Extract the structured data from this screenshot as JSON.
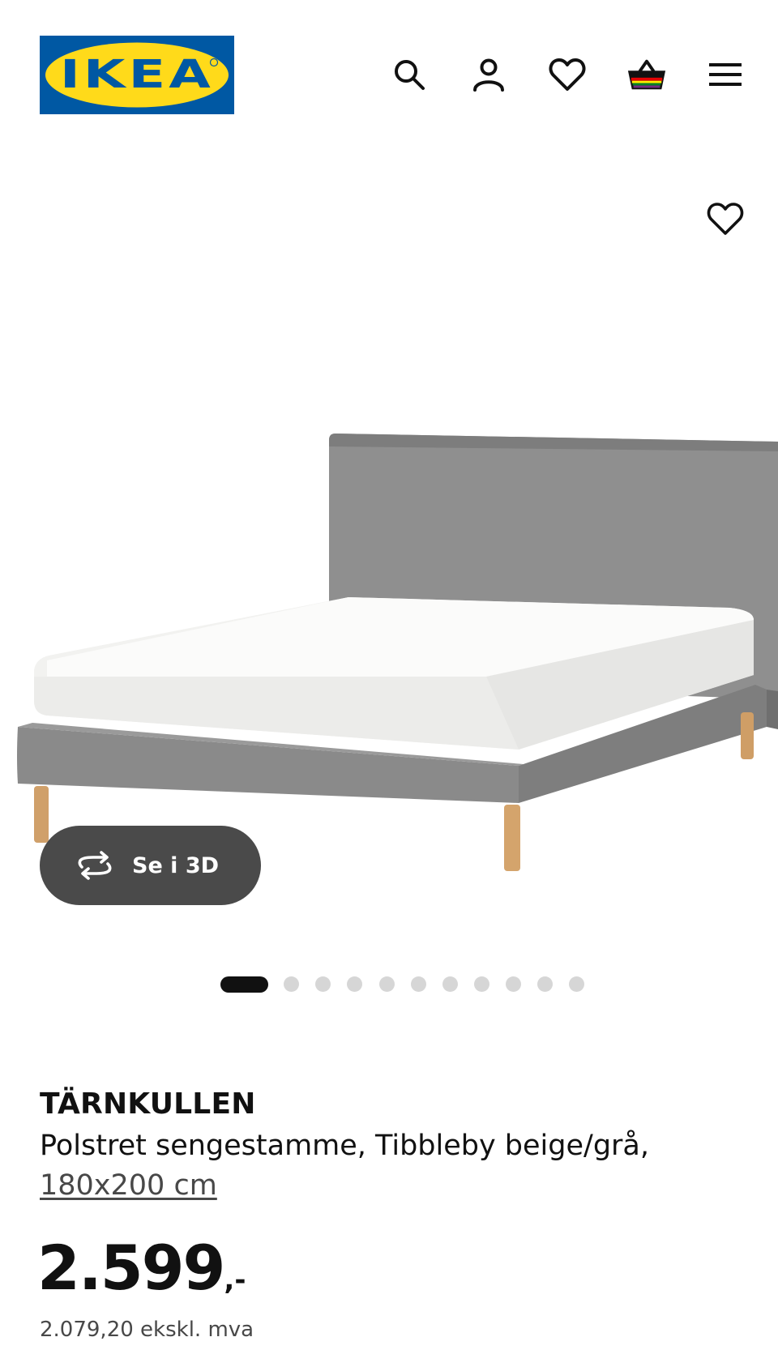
{
  "header": {
    "logo_text": "IKEA",
    "colors": {
      "logo_blue": "#0058a3",
      "logo_yellow": "#ffda1a"
    },
    "icons": [
      "search-icon",
      "user-icon",
      "heart-icon",
      "cart-icon",
      "menu-icon"
    ]
  },
  "hero": {
    "fav_icon": "heart-outline-icon",
    "view_3d_label": "Se i 3D",
    "view_3d_icon": "rotate-3d-icon",
    "image_count": 12,
    "active_image_index": 0
  },
  "product": {
    "name": "TÄRNKULLEN",
    "description": "Polstret sengestamme, Tibbleby beige/grå,",
    "size": "180x200 cm",
    "price": "2.599",
    "price_suffix": ",-",
    "price_ex_vat": "2.079,20 ekskl. mva"
  }
}
